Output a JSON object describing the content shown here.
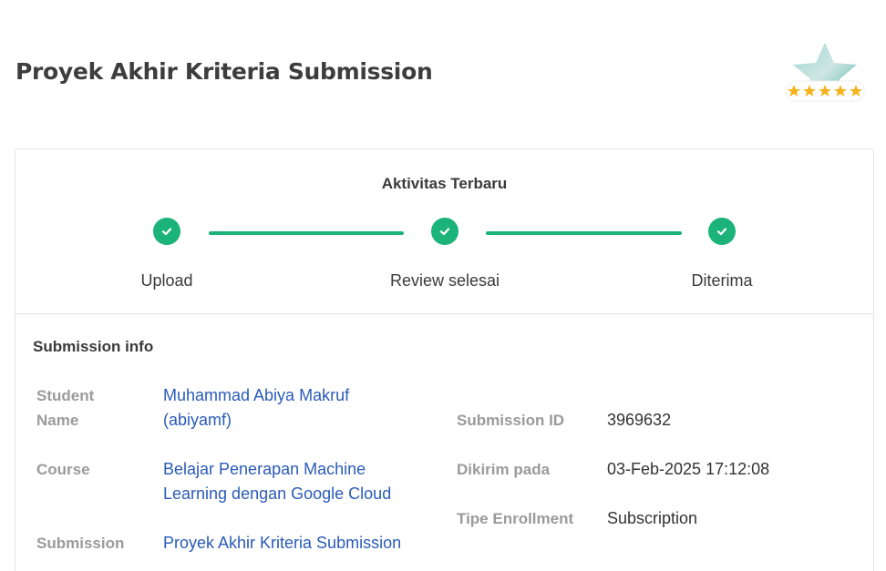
{
  "page": {
    "title": "Proyek Akhir Kriteria Submission",
    "badge_icon": "five-star-rating-badge-icon"
  },
  "activity": {
    "title": "Aktivitas Terbaru",
    "steps": [
      {
        "label": "Upload",
        "status": "done"
      },
      {
        "label": "Review selesai",
        "status": "done"
      },
      {
        "label": "Diterima",
        "status": "done"
      }
    ],
    "accent_color": "#1bb37a"
  },
  "submission_info": {
    "title": "Submission info",
    "student_name_label_line1": "Student",
    "student_name_label_line2": "Name",
    "student_name_line1": "Muhammad Abiya Makruf",
    "student_name_line2": "(abiyamf)",
    "course_label": "Course",
    "course_line1": "Belajar Penerapan Machine",
    "course_line2": "Learning dengan Google Cloud",
    "submission_label": "Submission",
    "submission_value": "Proyek Akhir Kriteria Submission",
    "submission_id_label": "Submission ID",
    "submission_id_value": "3969632",
    "sent_at_label": "Dikirim pada",
    "sent_at_value": "03-Feb-2025 17:12:08",
    "enrollment_type_label": "Tipe Enrollment",
    "enrollment_type_value": "Subscription",
    "link_color": "#2a5bb8"
  }
}
